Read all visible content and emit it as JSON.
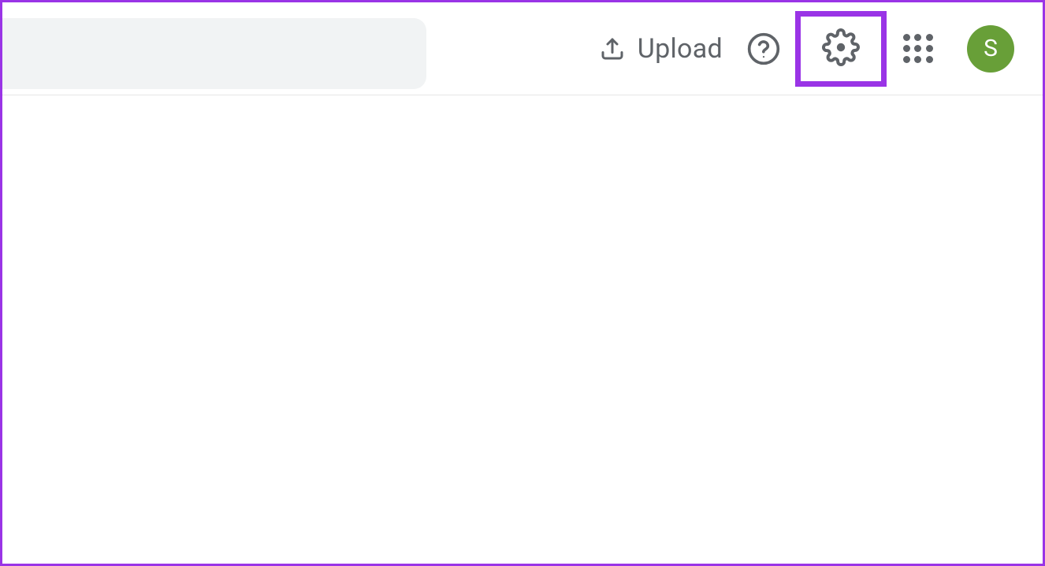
{
  "header": {
    "upload_label": "Upload",
    "avatar_initial": "S"
  },
  "colors": {
    "highlight": "#9a34e6",
    "avatar_bg": "#689f38",
    "icon_color": "#5f6368",
    "search_bg": "#f1f3f4"
  }
}
